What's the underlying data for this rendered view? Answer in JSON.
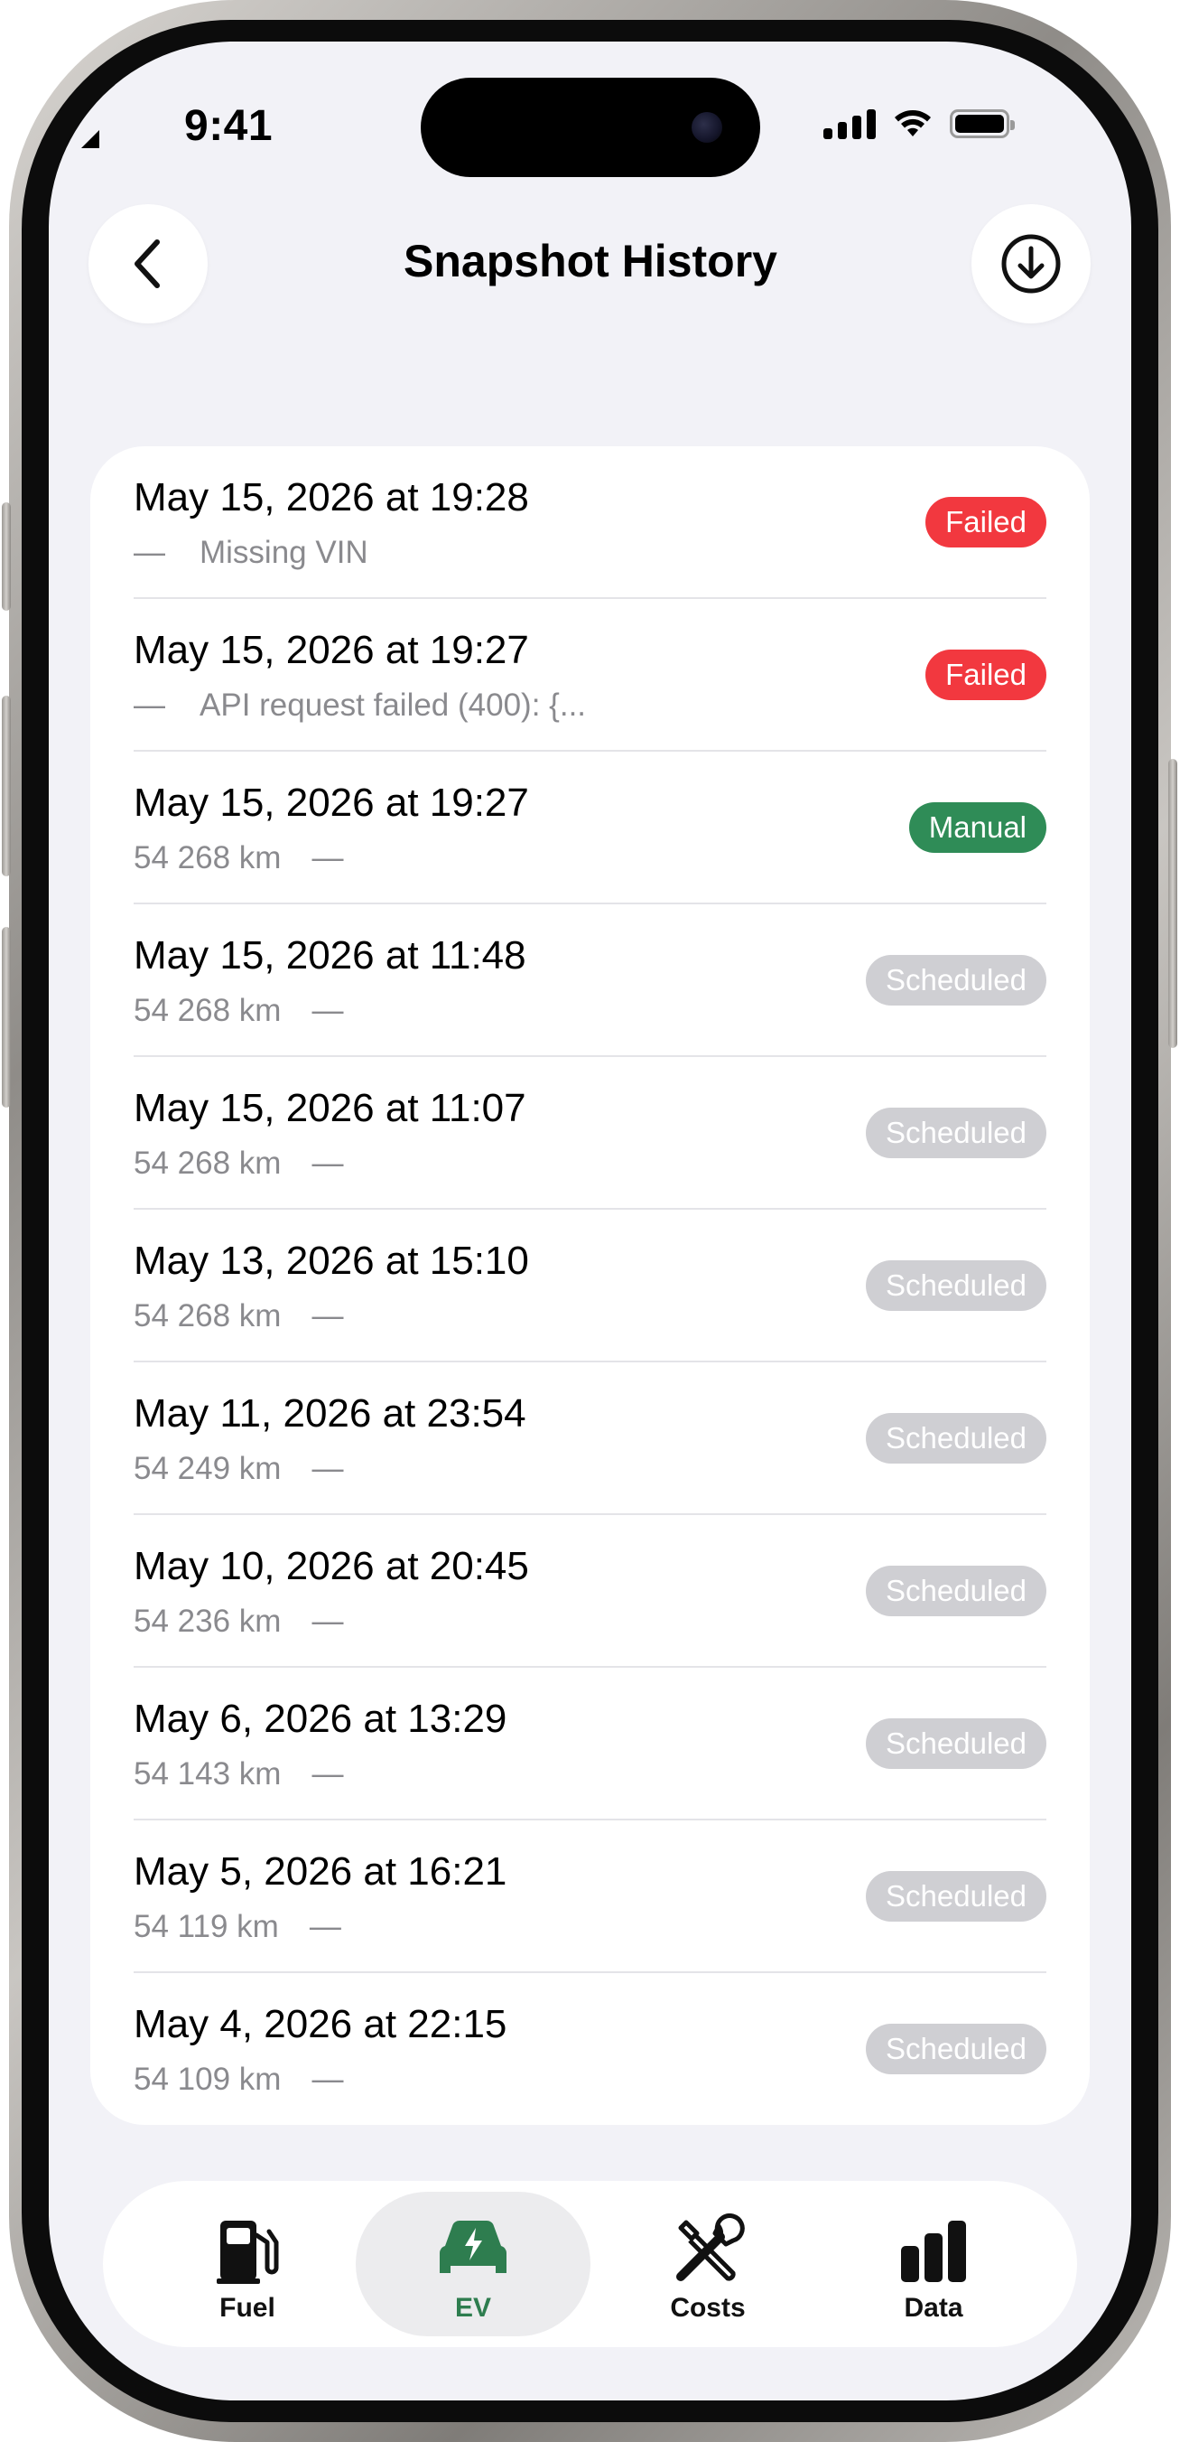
{
  "status_bar": {
    "time": "9:41"
  },
  "nav": {
    "title": "Snapshot History",
    "back_icon": "chevron-left-icon",
    "action_icon": "download-circle-icon"
  },
  "colors": {
    "failed": "#f2383f",
    "manual": "#2f8c57",
    "scheduled": "#cfcfd3",
    "active_tab": "#2e7d4f"
  },
  "snapshots": [
    {
      "date": "May 15, 2026 at 19:28",
      "odometer": "",
      "detail": "Missing VIN",
      "status": "Failed",
      "kind": "failed"
    },
    {
      "date": "May 15, 2026 at 19:27",
      "odometer": "",
      "detail": "API request failed (400): {...",
      "status": "Failed",
      "kind": "failed"
    },
    {
      "date": "May 15, 2026 at 19:27",
      "odometer": "54 268 km",
      "detail": "",
      "status": "Manual",
      "kind": "manual"
    },
    {
      "date": "May 15, 2026 at 11:48",
      "odometer": "54 268 km",
      "detail": "",
      "status": "Scheduled",
      "kind": "scheduled"
    },
    {
      "date": "May 15, 2026 at 11:07",
      "odometer": "54 268 km",
      "detail": "",
      "status": "Scheduled",
      "kind": "scheduled"
    },
    {
      "date": "May 13, 2026 at 15:10",
      "odometer": "54 268 km",
      "detail": "",
      "status": "Scheduled",
      "kind": "scheduled"
    },
    {
      "date": "May 11, 2026 at 23:54",
      "odometer": "54 249 km",
      "detail": "",
      "status": "Scheduled",
      "kind": "scheduled"
    },
    {
      "date": "May 10, 2026 at 20:45",
      "odometer": "54 236 km",
      "detail": "",
      "status": "Scheduled",
      "kind": "scheduled"
    },
    {
      "date": "May 6, 2026 at 13:29",
      "odometer": "54 143 km",
      "detail": "",
      "status": "Scheduled",
      "kind": "scheduled"
    },
    {
      "date": "May 5, 2026 at 16:21",
      "odometer": "54 119 km",
      "detail": "",
      "status": "Scheduled",
      "kind": "scheduled"
    },
    {
      "date": "May 4, 2026 at 22:15",
      "odometer": "54 109 km",
      "detail": "",
      "status": "Scheduled",
      "kind": "scheduled"
    }
  ],
  "dash": "—",
  "tabs": [
    {
      "label": "Fuel",
      "icon": "fuel-pump-icon",
      "active": false
    },
    {
      "label": "EV",
      "icon": "ev-car-icon",
      "active": true
    },
    {
      "label": "Costs",
      "icon": "tools-icon",
      "active": false
    },
    {
      "label": "Data",
      "icon": "bar-chart-icon",
      "active": false
    }
  ]
}
